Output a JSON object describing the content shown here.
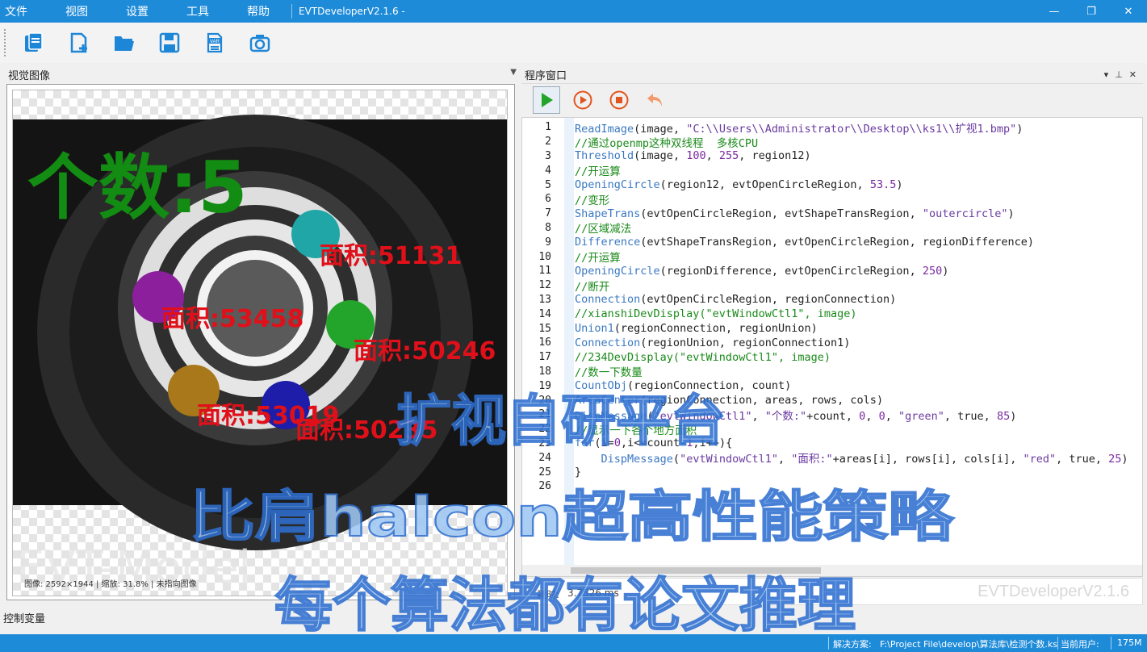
{
  "menu": {
    "items": [
      "文件",
      "视图",
      "设置",
      "工具",
      "帮助"
    ],
    "app_title": "EVTDeveloperV2.1.6 -"
  },
  "toolbar": {
    "icons": [
      "new-project-icon",
      "new-file-icon",
      "open-folder-icon",
      "save-icon",
      "var-file-icon",
      "camera-icon"
    ]
  },
  "left_pane": {
    "title": "视觉图像",
    "status": "图像: 2592×1944 | 缩放: 31.8% | 未指向图像",
    "watermark": "EVT-Model"
  },
  "image_overlay": {
    "count_label": "个数:5",
    "areas": [
      "面积:51131",
      "面积:53458",
      "面积:50246",
      "面积:53019",
      "面积:50235"
    ],
    "colors": {
      "count": "#128c12",
      "area": "#e0101a"
    }
  },
  "bottom_tab": "控制变量",
  "program": {
    "title": "程序窗口",
    "header_controls": [
      "▾",
      "⊥",
      "✕"
    ],
    "buttons": [
      "run-icon",
      "step-icon",
      "stop-icon",
      "undo-icon"
    ],
    "lines": [
      {
        "n": "1",
        "t": "ReadImage(image, \"C:\\\\Users\\\\Administrator\\\\Desktop\\\\ks1\\\\扩视1.bmp\")"
      },
      {
        "n": "2",
        "t": "//通过openmp这种双线程  多核CPU"
      },
      {
        "n": "3",
        "t": "Threshold(image, 100, 255, region12)"
      },
      {
        "n": "4",
        "t": "//开运算"
      },
      {
        "n": "5",
        "t": "OpeningCircle(region12, evtOpenCircleRegion, 53.5)"
      },
      {
        "n": "6",
        "t": "//变形"
      },
      {
        "n": "7",
        "t": "ShapeTrans(evtOpenCircleRegion, evtShapeTransRegion, \"outercircle\")"
      },
      {
        "n": "8",
        "t": "//区域减法"
      },
      {
        "n": "9",
        "t": "Difference(evtShapeTransRegion, evtOpenCircleRegion, regionDifference)"
      },
      {
        "n": "10",
        "t": "//开运算"
      },
      {
        "n": "11",
        "t": "OpeningCircle(regionDifference, evtOpenCircleRegion, 250)"
      },
      {
        "n": "12",
        "t": "//断开"
      },
      {
        "n": "13",
        "t": "Connection(evtOpenCircleRegion, regionConnection)"
      },
      {
        "n": "14",
        "t": "//xianshiDevDisplay(\"evtWindowCtl1\", image)"
      },
      {
        "n": "15",
        "t": "Union1(regionConnection, regionUnion)"
      },
      {
        "n": "16",
        "t": "Connection(regionUnion, regionConnection1)"
      },
      {
        "n": "17",
        "t": "//234DevDisplay(\"evtWindowCtl1\", image)"
      },
      {
        "n": "18",
        "t": "//数一下数量"
      },
      {
        "n": "19",
        "t": "CountObj(regionConnection, count)"
      },
      {
        "n": "20",
        "t": "AreaCenter(regionConnection, areas, rows, cols)"
      },
      {
        "n": "21",
        "t": "DispMessage(\"evtWindowCtl1\", \"个数:\"+count, 0, 0, \"green\", true, 85)"
      },
      {
        "n": "22",
        "t": "//显示一下各个地方面积"
      },
      {
        "n": "23",
        "t": "for(i=0,i<=count-1,i++){"
      },
      {
        "n": "24",
        "t": "    DispMessage(\"evtWindowCtl1\", \"面积:\"+areas[i], rows[i], cols[i], \"red\", true, 25)"
      },
      {
        "n": "25",
        "t": "}"
      },
      {
        "n": "26",
        "t": ""
      }
    ],
    "exec_label": "耗时:",
    "exec_value": "3.7526  ms",
    "watermark": "EVTDeveloperV2.1.6"
  },
  "statusbar": {
    "solution_label": "解决方案:",
    "solution_path": "F:\\Project File\\develop\\算法库\\检测个数.ks",
    "user_label": "当前用户:",
    "memory": "175M"
  },
  "promo": {
    "line1": "扩视自研平台",
    "line2": "比肩halcon超高性能策略",
    "line3": "每个算法都有论文推理",
    "fill": "#9fc7f2",
    "stroke": "#2f6fd0"
  }
}
